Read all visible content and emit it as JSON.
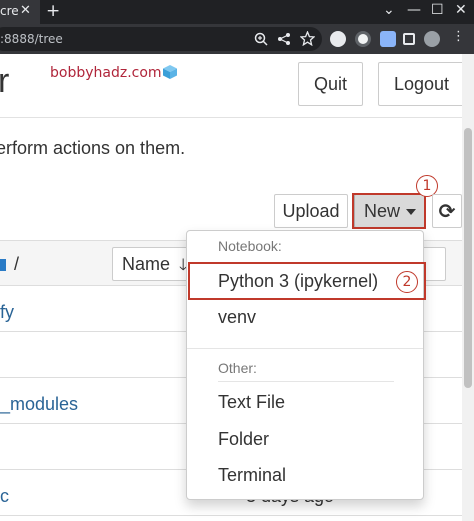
{
  "browser": {
    "tab_title": "cre",
    "tab_close": "✕",
    "new_tab": "+",
    "url": ":8888/tree",
    "win_chevron": "⌄",
    "win_min": "—",
    "win_max": "☐",
    "win_close": "✕",
    "menu_dots": "⋮"
  },
  "header": {
    "logo_letter": "r",
    "brand_text": "bobbyhadz.com",
    "quit_label": "Quit",
    "logout_label": "Logout"
  },
  "instructions": "erform actions on them.",
  "toolbar": {
    "upload_label": "Upload",
    "new_label": "New",
    "refresh_glyph": "⟳",
    "step1_badge": "1"
  },
  "file_list": {
    "path_sep": "/",
    "name_sort_label": "Name",
    "sort_arrow": "🡓",
    "right_sort_label": "e",
    "rows": [
      "fy",
      "_modules",
      "c"
    ],
    "last_modified": "3 days ago"
  },
  "new_menu": {
    "notebook_header": "Notebook:",
    "python_item": "Python 3 (ipykernel)",
    "venv_item": "venv",
    "other_header": "Other:",
    "text_file_item": "Text File",
    "folder_item": "Folder",
    "terminal_item": "Terminal",
    "step2_badge": "2"
  },
  "colors": {
    "highlight": "#c0392b",
    "brand": "#b0253a",
    "link": "#2a6496"
  }
}
